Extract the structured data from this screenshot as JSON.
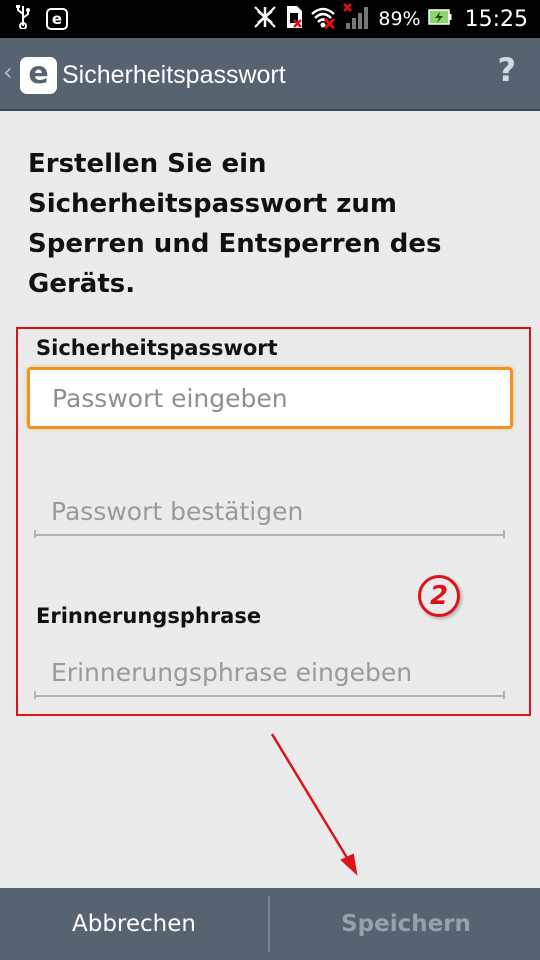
{
  "status_bar": {
    "battery_percent": "89%",
    "time": "15:25",
    "notification_icons": [
      "usb-icon",
      "eset-icon"
    ],
    "system_icons": [
      "no-connection-icon",
      "sim-icon",
      "wifi-off-icon",
      "signal-icon",
      "battery-icon"
    ]
  },
  "action_bar": {
    "back_symbol": "‹",
    "logo_letter": "e",
    "title": "Sicherheitspasswort",
    "help_symbol": "?"
  },
  "heading": "Erstellen Sie ein Sicherheitspasswort zum Sperren und Entsperren des Geräts.",
  "form": {
    "password_label": "Sicherheitspasswort",
    "password_placeholder": "Passwort eingeben",
    "password_value": "",
    "confirm_placeholder": "Passwort bestätigen",
    "confirm_value": "",
    "hint_label": "Erinnerungsphrase",
    "hint_placeholder": "Erinnerungsphrase eingeben",
    "hint_value": ""
  },
  "annotation": {
    "step_number": "2",
    "color": "#e01219"
  },
  "bottom_bar": {
    "cancel_label": "Abbrechen",
    "save_label": "Speichern"
  },
  "colors": {
    "action_bar": "#586370",
    "focus_accent": "#f4921f",
    "background": "#ebebeb"
  }
}
